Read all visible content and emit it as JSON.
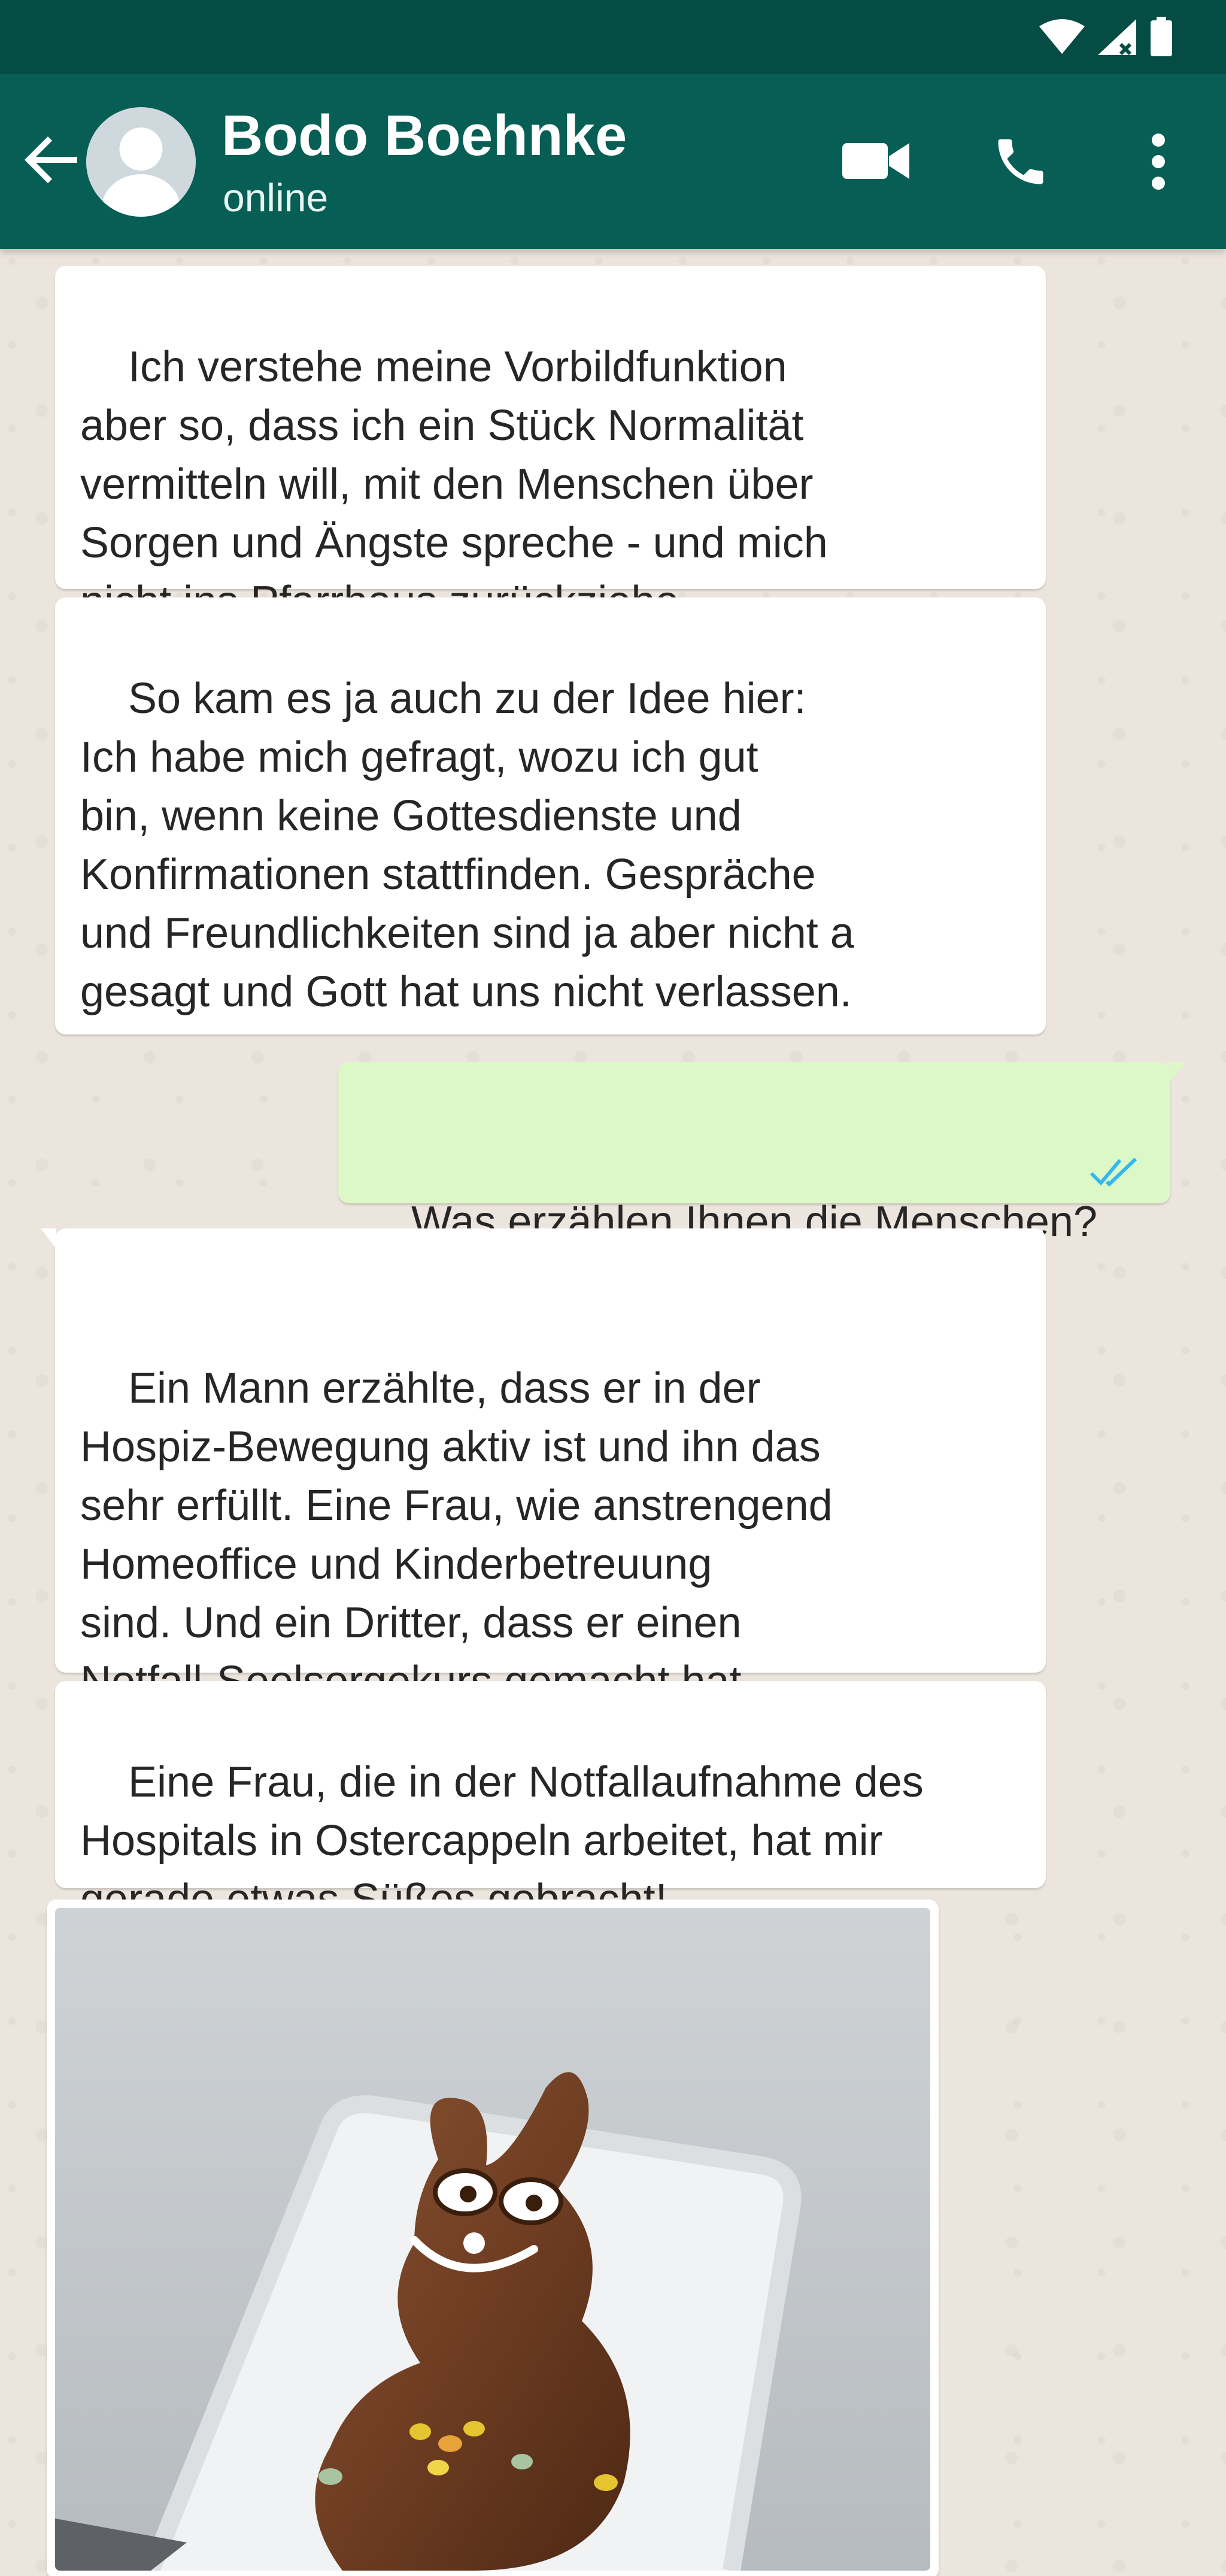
{
  "header": {
    "contact_name": "Bodo Boehnke",
    "status": "online",
    "back_icon": "arrow-left-icon",
    "video_icon": "video-call-icon",
    "call_icon": "phone-icon",
    "menu_icon": "more-vertical-icon"
  },
  "status_bar": {
    "icons": [
      "wifi-icon",
      "signal-icon",
      "battery-icon"
    ]
  },
  "messages": [
    {
      "direction": "incoming",
      "text": "Ich verstehe meine Vorbildfunktion\naber so, dass ich ein Stück Normalität\nvermitteln will, mit den Menschen über\nSorgen und Ängste spreche - und mich\nnicht ins Pfarrhaus zurückziehe."
    },
    {
      "direction": "incoming",
      "text": "So kam es ja auch zu der Idee hier:\nIch habe mich gefragt, wozu ich gut\nbin, wenn keine Gottesdienste und\nKonfirmationen stattfinden. Gespräche\nund Freundlichkeiten sind ja aber nicht a\ngesagt und Gott hat uns nicht verlassen."
    },
    {
      "direction": "outgoing",
      "text": "Was erzählen Ihnen die Menschen?",
      "read_status": "read"
    },
    {
      "direction": "incoming",
      "text": "Ein Mann erzählte, dass er in der\nHospiz-Bewegung aktiv ist und ihn das\nsehr erfüllt. Eine Frau, wie anstrengend\nHomeoffice und Kinderbetreuung\nsind. Und ein Dritter, dass er einen\nNotfall-Seelsorgekurs gemacht hat.\nIch erfahre viel Neues!"
    },
    {
      "direction": "incoming",
      "text": "Eine Frau, die in der Notfallaufnahme des\nHospitals in Ostercappeln arbeitet, hat mir\ngerade etwas Süßes gebracht!"
    },
    {
      "direction": "incoming",
      "type": "image",
      "content": "chocolate-bunny-photo"
    }
  ],
  "colors": {
    "header": "#075e54",
    "status_bar": "#054d44",
    "chat_background": "#ece5dd",
    "incoming_bubble": "#ffffff",
    "outgoing_bubble": "#dcf8c6",
    "read_check": "#34b7f1"
  }
}
